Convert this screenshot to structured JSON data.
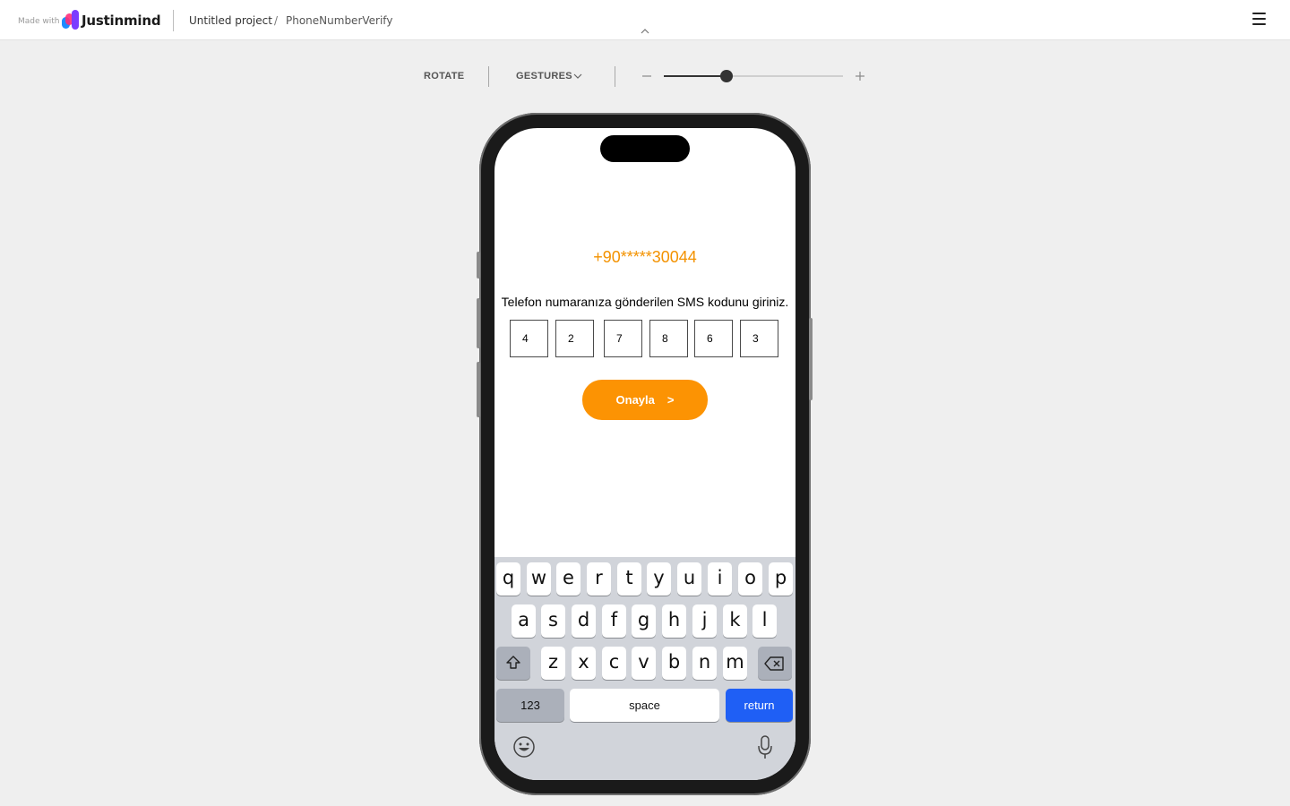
{
  "header": {
    "made_with": "Made with",
    "brand": "Justinmind",
    "project": "Untitled project",
    "separator": "/",
    "screen": "PhoneNumberVerify"
  },
  "toolbar": {
    "rotate_label": "ROTATE",
    "gestures_label": "GESTURES",
    "zoom_level": 0.35
  },
  "app": {
    "phone_number": "+90*****30044",
    "instruction": "Telefon numaranıza gönderilen SMS kodunu giriniz.",
    "code_digits": [
      "4",
      "2",
      "7",
      "8",
      "6",
      "3"
    ],
    "confirm_label": "Onayla",
    "confirm_arrow": ">"
  },
  "keyboard": {
    "row1": [
      "q",
      "w",
      "e",
      "r",
      "t",
      "y",
      "u",
      "i",
      "o",
      "p"
    ],
    "row2": [
      "a",
      "s",
      "d",
      "f",
      "g",
      "h",
      "j",
      "k",
      "l"
    ],
    "row3": [
      "z",
      "x",
      "c",
      "v",
      "b",
      "n",
      "m"
    ],
    "numbers_label": "123",
    "space_label": "space",
    "return_label": "return"
  },
  "colors": {
    "accent": "#fc9303",
    "phone_number": "#f39200",
    "return_key": "#1f5ff5"
  }
}
